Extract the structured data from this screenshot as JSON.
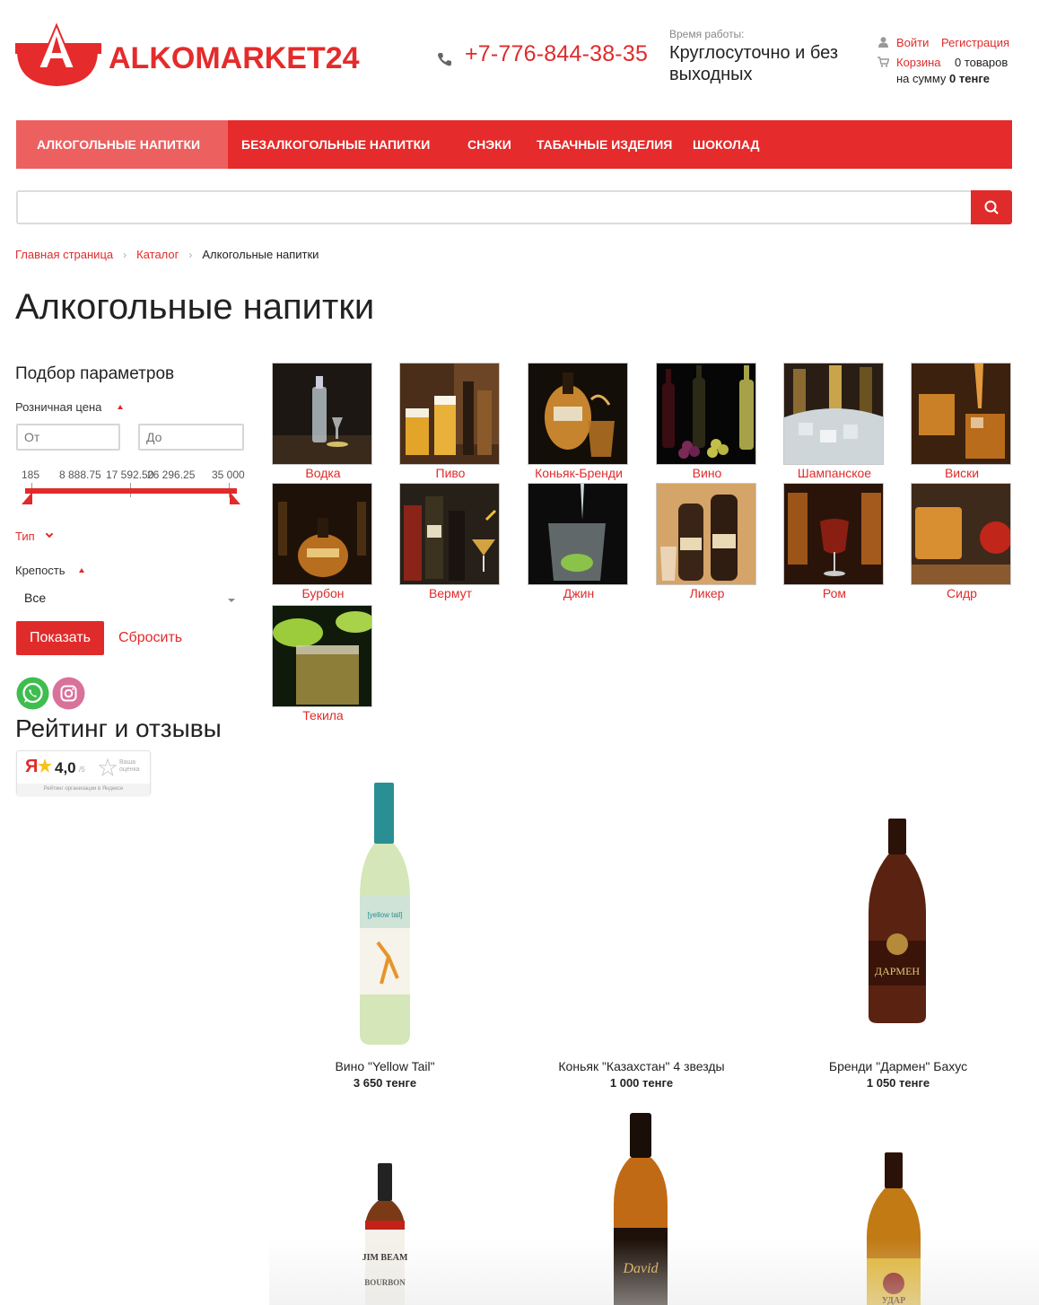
{
  "header": {
    "logo_text": "ALKOMARKET24",
    "phone": "+7-776-844-38-35",
    "hours_label": "Время работы:",
    "hours_value": "Круглосуточно и без выходных",
    "login": "Войти",
    "register": "Регистрация",
    "cart_label": "Корзина",
    "cart_count": "0 товаров",
    "cart_sum_label": "на сумму",
    "cart_sum_value": "0 тенге"
  },
  "nav": {
    "items": [
      {
        "label": "Алкогольные напитки",
        "active": true
      },
      {
        "label": "Безалкогольные напитки"
      },
      {
        "label": "Снэки"
      },
      {
        "label": "Табачные изделия"
      },
      {
        "label": "Шоколад"
      }
    ]
  },
  "search": {
    "placeholder": "",
    "value": ""
  },
  "breadcrumb": {
    "home": "Главная страница",
    "catalog": "Каталог",
    "current": "Алкогольные напитки"
  },
  "page_title": "Алкогольные напитки",
  "filter": {
    "title": "Подбор параметров",
    "price_label": "Розничная цена",
    "from_placeholder": "От",
    "to_placeholder": "До",
    "scale": [
      "185",
      "8 888.75",
      "17 592.50",
      "26 296.25",
      "35 000"
    ],
    "type_label": "Тип",
    "strength_label": "Крепость",
    "strength_value": "Все",
    "show_button": "Показать",
    "reset_button": "Сбросить"
  },
  "rating": {
    "title": "Рейтинг и отзывы",
    "score": "4,0",
    "out_of": "/5",
    "your_rating": "Ваша оценка",
    "caption": "Рейтинг организации в Яндексе"
  },
  "categories": [
    "Водка",
    "Пиво",
    "Коньяк-Бренди",
    "Вино",
    "Шампанское",
    "Виски",
    "Бурбон",
    "Вермут",
    "Джин",
    "Ликер",
    "Ром",
    "Сидр",
    "Текила"
  ],
  "products": [
    {
      "name": "Вино \"Yellow Tail\"",
      "price": "3 650 тенге"
    },
    {
      "name": "Коньяк \"Казахстан\" 4 звезды",
      "price": "1 000 тенге"
    },
    {
      "name": "Бренди \"Дармен\" Бахус",
      "price": "1 050 тенге"
    },
    {
      "name": "",
      "price": ""
    },
    {
      "name": "",
      "price": ""
    },
    {
      "name": "",
      "price": ""
    }
  ],
  "colors": {
    "accent": "#e52b2b",
    "nav_active": "#ec6060",
    "link": "#e02b2b"
  }
}
